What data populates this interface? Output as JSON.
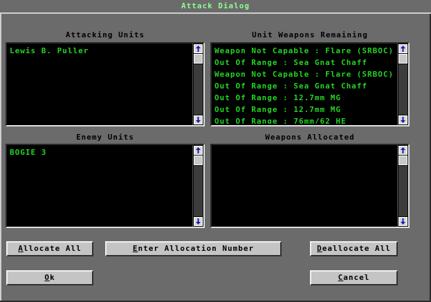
{
  "window": {
    "title": "Attack Dialog"
  },
  "attacking_units": {
    "label": "Attacking Units",
    "items": [
      "Lewis B. Puller"
    ]
  },
  "unit_weapons_remaining": {
    "label": "Unit Weapons Remaining",
    "items": [
      "Weapon Not Capable : Flare (SRBOC)",
      "Out Of Range : Sea Gnat Chaff",
      "Weapon Not Capable : Flare (SRBOC)",
      "Out Of Range : Sea Gnat Chaff",
      "Out Of Range : 12.7mm MG",
      "Out Of Range : 12.7mm MG",
      "Out Of Range : 76mm/62 HE"
    ]
  },
  "enemy_units": {
    "label": "Enemy Units",
    "items": [
      "BOGIE 3"
    ]
  },
  "weapons_allocated": {
    "label": "Weapons Allocated",
    "items": []
  },
  "buttons": {
    "allocate_all": {
      "hotkey": "A",
      "rest": "llocate All"
    },
    "enter_allocation_number": {
      "hotkey": "E",
      "rest": "nter Allocation Number"
    },
    "deallocate_all": {
      "hotkey": "D",
      "rest": "eallocate All"
    },
    "ok": {
      "hotkey": "O",
      "rest": "k"
    },
    "cancel": {
      "hotkey": "C",
      "rest": "ancel"
    }
  },
  "colors": {
    "title_text": "#8cff8c",
    "list_text": "#22d622",
    "list_bg": "#000000",
    "dialog_bg": "#6b6b6b"
  },
  "icons": {
    "scroll_up": "arrow-up-icon",
    "scroll_down": "arrow-down-icon"
  }
}
